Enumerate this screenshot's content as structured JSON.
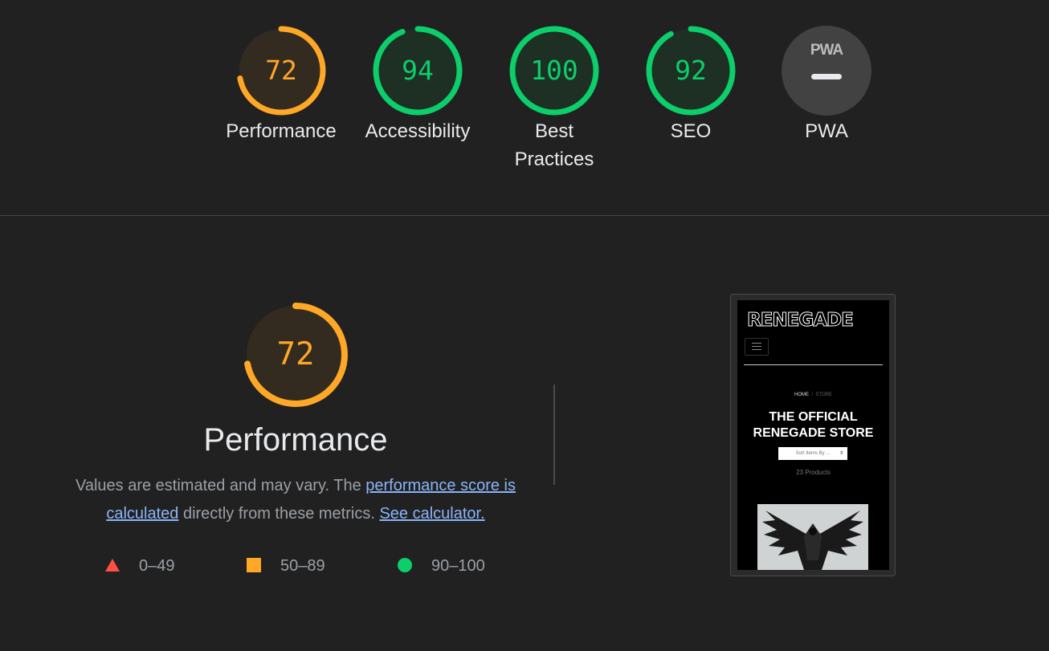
{
  "gauges": [
    {
      "label": "Performance",
      "score": "72",
      "value": 72,
      "color": "#ffa726",
      "fill": "#332b1f"
    },
    {
      "label": "Accessibility",
      "score": "94",
      "value": 94,
      "color": "#0cce6b",
      "fill": "#1e2f23"
    },
    {
      "label": "Best Practices",
      "label_line1": "Best",
      "label_line2": "Practices",
      "score": "100",
      "value": 100,
      "color": "#0cce6b",
      "fill": "#1e2f23"
    },
    {
      "label": "SEO",
      "score": "92",
      "value": 92,
      "color": "#0cce6b",
      "fill": "#1e2f23"
    },
    {
      "label": "PWA",
      "badge_text": "PWA",
      "icon": "pwa-dash-icon"
    }
  ],
  "performance": {
    "score": "72",
    "value": 72,
    "title": "Performance",
    "desc_prefix": "Values are estimated and may vary. The ",
    "link_score_calc": "performance score is calculated",
    "desc_middle": " directly from these metrics. ",
    "link_calculator": "See calculator."
  },
  "legend": [
    {
      "range": "0–49",
      "icon": "triangle-icon",
      "color": "#ff4e42"
    },
    {
      "range": "50–89",
      "icon": "square-icon",
      "color": "#ffa726"
    },
    {
      "range": "90–100",
      "icon": "circle-icon",
      "color": "#0cce6b"
    }
  ],
  "screenshot": {
    "logo": "RENEGADE",
    "breadcrumb_home": "HOME",
    "breadcrumb_sep": "/",
    "breadcrumb_store": "STORE",
    "title_line1": "THE OFFICIAL",
    "title_line2": "RENEGADE STORE",
    "sort_placeholder": "Sort Items By ...",
    "product_count": "23 Products"
  }
}
